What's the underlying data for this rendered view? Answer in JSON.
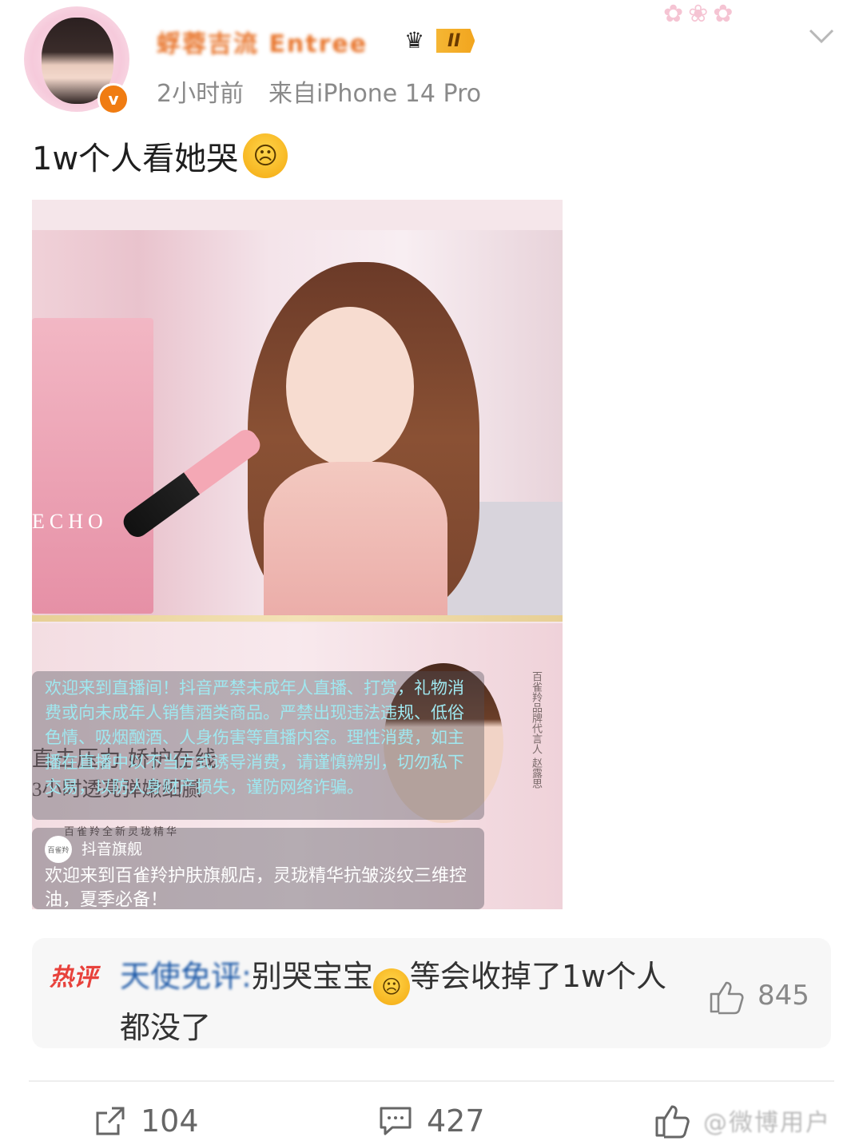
{
  "header": {
    "username": "蜉蓉吉流 Entree",
    "level": "II",
    "time": "2小时前",
    "source": "来自iPhone 14 Pro",
    "verified_mark": "v"
  },
  "post": {
    "text": "1w个人看她哭",
    "emoji": "loudly-crying-face"
  },
  "image": {
    "bottle_text": "ECHO",
    "overlay_notice": "欢迎来到直播间！抖音严禁未成年人直播、打赏，礼物消费或向未成年人销售酒类商品。严禁出现违法违规、低俗色情、吸烟酗酒、人身伤害等直播内容。理性消费，如主播在直播中以不当方式诱导消费，请谨慎辨别，切勿私下交易，以防人身财产损失，谨防网络诈骗。",
    "background_line1": "直击压力 娇护在线",
    "background_line2": "3小时透亮弹嫩细腻",
    "small_caption": "百雀羚全新灵珑精华",
    "shop_logo": "百雀羚",
    "shop_tag": "抖音旗舰",
    "shop_desc": "欢迎来到百雀羚护肤旗舰店，灵珑精华抗皱淡纹三维控油，夏季必备！",
    "signature": "百雀羚品牌代言人 赵露思"
  },
  "hot_comment": {
    "label": "热评",
    "user": "天使免评:",
    "text_part1": "别哭宝宝",
    "emoji": "sad-face",
    "text_part2": "等会收掉了1w个人都没了",
    "likes": "845"
  },
  "actions": {
    "reposts": "104",
    "comments": "427"
  },
  "watermark": "@微博用户"
}
